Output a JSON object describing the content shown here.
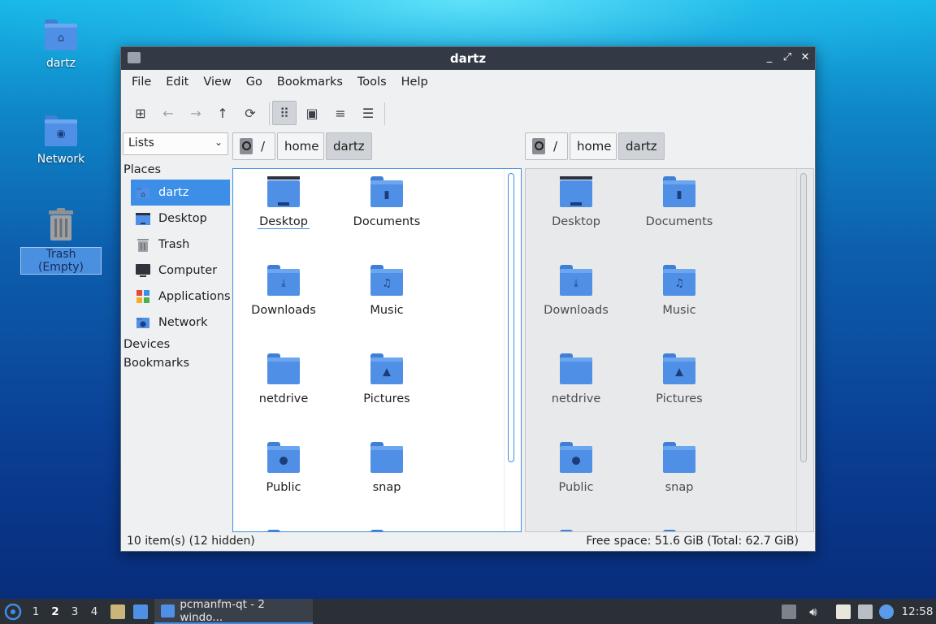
{
  "desktop": {
    "icons": [
      {
        "label": "dartz",
        "icon": "home-folder-icon"
      },
      {
        "label": "Network",
        "icon": "network-folder-icon"
      },
      {
        "label": "Trash (Empty)",
        "icon": "trash-icon"
      }
    ]
  },
  "window": {
    "title": "dartz",
    "controls": {
      "minimize": "_",
      "maximize": "⤢",
      "close": "✕"
    }
  },
  "menubar": [
    "File",
    "Edit",
    "View",
    "Go",
    "Bookmarks",
    "Tools",
    "Help"
  ],
  "toolbar": {
    "icons": [
      "new-tab-icon",
      "back-icon",
      "forward-icon",
      "up-icon",
      "reload-icon",
      "icon-view-icon",
      "thumbnail-view-icon",
      "compact-view-icon",
      "detailed-list-icon"
    ],
    "glyphs": {
      "new_tab": "⊞",
      "back": "←",
      "forward": "→",
      "up": "↑",
      "reload": "⟳",
      "icon_view": "⠿",
      "thumb": "▣",
      "compact": "≡",
      "list": "☰"
    }
  },
  "sidebar": {
    "selector": "Lists",
    "places_heading": "Places",
    "items": [
      {
        "label": "dartz",
        "icon": "home-icon",
        "selected": true
      },
      {
        "label": "Desktop",
        "icon": "desktop-icon"
      },
      {
        "label": "Trash",
        "icon": "trash-icon"
      },
      {
        "label": "Computer",
        "icon": "computer-icon"
      },
      {
        "label": "Applications",
        "icon": "applications-icon"
      },
      {
        "label": "Network",
        "icon": "network-icon"
      }
    ],
    "devices_heading": "Devices",
    "bookmarks_heading": "Bookmarks"
  },
  "pathbar_left": {
    "root": "/",
    "segments": [
      "home",
      "dartz"
    ]
  },
  "pathbar_right": {
    "root": "/",
    "segments": [
      "home",
      "dartz"
    ]
  },
  "files": [
    {
      "name": "Desktop",
      "type": "desktop"
    },
    {
      "name": "Documents",
      "type": "documents",
      "glyph": "▮"
    },
    {
      "name": "Downloads",
      "type": "downloads",
      "glyph": "⤓"
    },
    {
      "name": "Music",
      "type": "music",
      "glyph": "♫"
    },
    {
      "name": "netdrive",
      "type": "plain"
    },
    {
      "name": "Pictures",
      "type": "pictures",
      "glyph": "▲"
    },
    {
      "name": "Public",
      "type": "public",
      "glyph": "●"
    },
    {
      "name": "snap",
      "type": "plain"
    }
  ],
  "statusbar": {
    "items": "10 item(s) (12 hidden)",
    "free_space": "Free space: 51.6 GiB (Total: 62.7 GiB)"
  },
  "taskbar": {
    "desktops": [
      "1",
      "2",
      "3",
      "4"
    ],
    "current_desktop": "2",
    "task_label": "pcmanfm-qt - 2 windo...",
    "clock": "12:58"
  },
  "colors": {
    "accent": "#3d8ee6",
    "folder": "#4f90e6",
    "titlebar": "#333a45",
    "taskbar": "#2b2f36"
  }
}
